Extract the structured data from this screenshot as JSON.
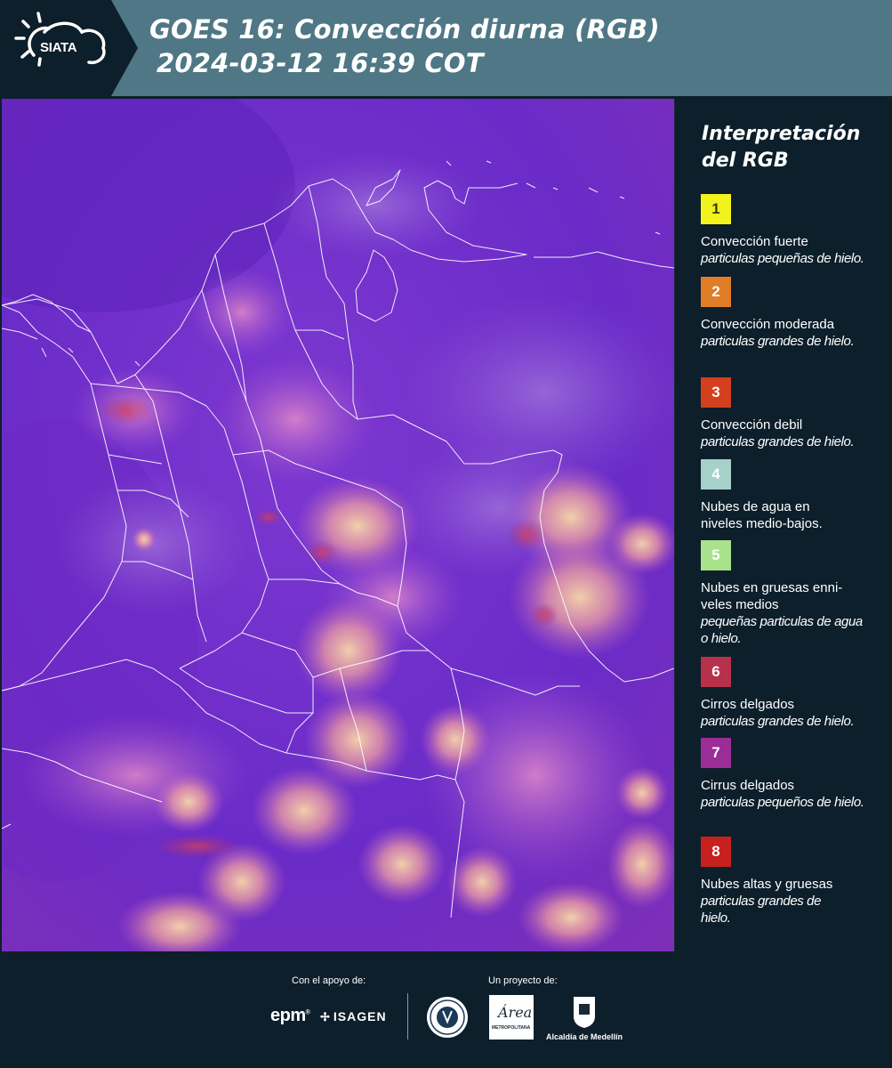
{
  "header": {
    "logo_text": "SIATA",
    "title_line1": "GOES 16: Convección diurna (RGB)",
    "title_line2": "2024-03-12 16:39 COT",
    "bg_color": "#4f7785"
  },
  "legend": {
    "title_line1": "Interpretación",
    "title_line2": "del RGB",
    "items": [
      {
        "num": "1",
        "color": "#f2f21c",
        "text_color": "#3a3a10",
        "name": "Convección fuerte",
        "desc": "particulas pequeñas de hielo."
      },
      {
        "num": "2",
        "color": "#e07d26",
        "text_color": "#ffffff",
        "name": "Convección moderada",
        "desc": "particulas grandes de hielo."
      },
      {
        "num": "3",
        "color": "#d3401d",
        "text_color": "#ffffff",
        "name": "Convección debil",
        "desc": "particulas grandes de hielo."
      },
      {
        "num": "4",
        "color": "#a6d0ca",
        "text_color": "#ffffff",
        "name": "Nubes de agua en niveles medio-bajos.",
        "desc": ""
      },
      {
        "num": "5",
        "color": "#a8e28a",
        "text_color": "#ffffff",
        "name": "Nubes en gruesas enni-veles medios",
        "desc": "pequeñas particulas de agua o hielo."
      },
      {
        "num": "6",
        "color": "#b7314a",
        "text_color": "#ffffff",
        "name": "Cirros delgados",
        "desc": "particulas grandes de hielo."
      },
      {
        "num": "7",
        "color": "#9c2c96",
        "text_color": "#ffffff",
        "name": "Cirrus delgados",
        "desc": "particulas pequeños de hielo."
      },
      {
        "num": "8",
        "color": "#c81f1f",
        "text_color": "#ffffff",
        "name": "Nubes altas y gruesas",
        "desc": "particulas grandes de hielo."
      }
    ]
  },
  "footer": {
    "support_label": "Con el apoyo de:",
    "project_label": "Un proyecto de:",
    "epm_logo": "epm",
    "isagen_logo": "ISAGEN",
    "area_logo": "Área",
    "area_sub": "METROPOLITANA",
    "alcaldia_label": "Alcaldía de Medellín"
  }
}
